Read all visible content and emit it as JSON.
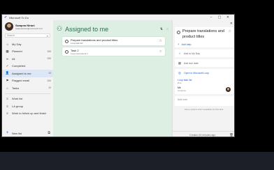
{
  "window": {
    "title": "Microsoft To Do",
    "controls": [
      "–",
      "▢",
      "✕"
    ]
  },
  "profile": {
    "name": "Swapna Nirani",
    "email": "swapnanirani@microsoft.com"
  },
  "search": {
    "placeholder": "Search"
  },
  "sidebar": {
    "items": [
      {
        "label": "My Day",
        "icon": "sun-icon",
        "glyph": "☼",
        "count": ""
      },
      {
        "label": "Planned",
        "icon": "calendar-icon",
        "glyph": "▦",
        "count": "190"
      },
      {
        "label": "All",
        "icon": "all-icon",
        "glyph": "∞",
        "count": "190"
      },
      {
        "label": "Completed",
        "icon": "check-circle-icon",
        "glyph": "✓",
        "count": ""
      },
      {
        "label": "Assigned to me",
        "icon": "person-icon",
        "glyph": "👤",
        "count": "10"
      },
      {
        "label": "Flagged email",
        "icon": "flag-icon",
        "glyph": "⚑",
        "count": "100"
      },
      {
        "label": "Tasks",
        "icon": "home-icon",
        "glyph": "⌂",
        "count": "10"
      }
    ],
    "lists": [
      {
        "label": "Work list",
        "icon": "list-icon",
        "glyph": "≡",
        "count": ""
      },
      {
        "label": "LA group",
        "icon": "list-icon",
        "glyph": "≡",
        "count": ""
      },
      {
        "label": "Work to follow up and finish",
        "icon": "list-icon",
        "glyph": "≡",
        "count": ""
      }
    ],
    "new_list": "New list"
  },
  "main": {
    "title": "Assigned to me",
    "tasks": [
      {
        "title": "Prepare translations and product titles",
        "sub": "Loop task list"
      },
      {
        "title": "Task 2",
        "sub": "Loop component 1"
      }
    ]
  },
  "detail": {
    "task_title": "Prepare translations and product titles",
    "add_step": "Add step",
    "add_my_day": "Add to My Day",
    "add_due_date": "Add due date",
    "open_loop": "Open in Microsoft Loop",
    "loop_title": "Loop task list",
    "loop_sub": "Due",
    "assignee_name": "Me",
    "assignee_role": "Assignee",
    "note_placeholder": "Add note",
    "notice": "Some options aren't available for this task.",
    "created": "Created 49 minutes ago"
  },
  "colors": {
    "accent": "#2564cf",
    "main_bg": "#ddefe3",
    "main_title": "#2d6a4f"
  }
}
